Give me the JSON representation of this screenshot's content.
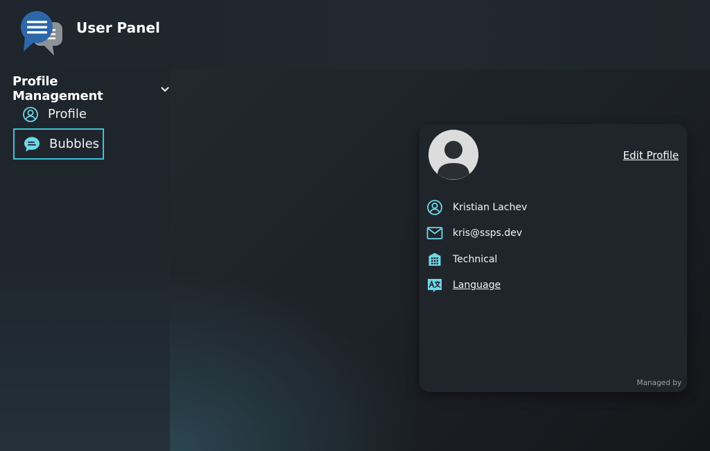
{
  "app": {
    "title": "User Panel",
    "logo_icon": "chat-bubbles-logo-icon"
  },
  "sidebar": {
    "section_title": "Profile Management",
    "section_icon": "chevron-down-icon",
    "items": [
      {
        "label": "Profile",
        "icon": "user-circle-icon",
        "selected": false
      },
      {
        "label": "Bubbles",
        "icon": "chat-bubble-icon",
        "selected": true
      }
    ]
  },
  "profile_card": {
    "avatar_icon": "user-avatar-icon",
    "edit_label": "Edit Profile",
    "name": "Kristian Lachev",
    "email": "kris@ssps.dev",
    "department": "Technical",
    "language_label": "Language",
    "footer": "Managed by"
  },
  "colors": {
    "accent": "#3cc3d7",
    "icon": "#6fd8e8",
    "background": "#1e232b",
    "card": "#20252c",
    "logo_blue": "#2d67a8",
    "logo_gray": "#8d9297"
  }
}
